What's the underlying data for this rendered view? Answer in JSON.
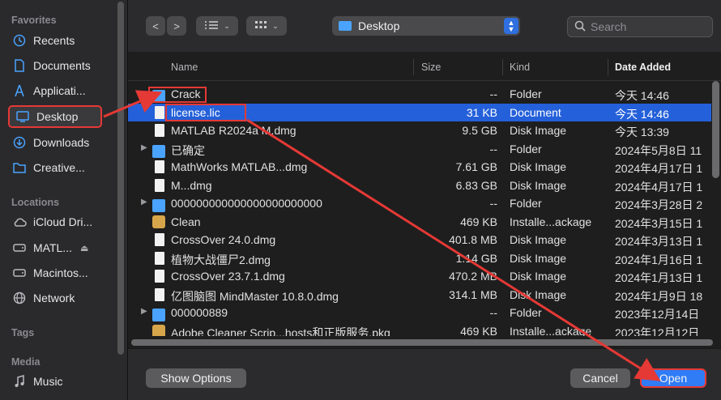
{
  "sidebar": {
    "favorites_label": "Favorites",
    "locations_label": "Locations",
    "tags_label": "Tags",
    "media_label": "Media",
    "favorites": [
      {
        "label": "Recents",
        "icon": "clock-icon"
      },
      {
        "label": "Documents",
        "icon": "document-icon"
      },
      {
        "label": "Applicati...",
        "icon": "applications-icon"
      },
      {
        "label": "Desktop",
        "icon": "desktop-icon"
      },
      {
        "label": "Downloads",
        "icon": "download-icon"
      },
      {
        "label": "Creative...",
        "icon": "folder-icon"
      }
    ],
    "locations": [
      {
        "label": "iCloud Dri...",
        "icon": "cloud-icon"
      },
      {
        "label": "MATL...",
        "icon": "disk-icon"
      },
      {
        "label": "Macintos...",
        "icon": "disk-icon"
      },
      {
        "label": "Network",
        "icon": "globe-icon"
      }
    ],
    "media": [
      {
        "label": "Music",
        "icon": "music-icon"
      }
    ]
  },
  "toolbar": {
    "back": "<",
    "forward": ">",
    "path_label": "Desktop",
    "search_placeholder": "Search"
  },
  "columns": {
    "name": "Name",
    "size": "Size",
    "kind": "Kind",
    "date": "Date Added"
  },
  "rows": [
    {
      "name": "Crack",
      "size": "--",
      "kind": "Folder",
      "date": "今天 14:46",
      "type": "folder",
      "expand": false
    },
    {
      "name": "license.lic",
      "size": "31 KB",
      "kind": "Document",
      "date": "今天 14:46",
      "type": "doc",
      "selected": true
    },
    {
      "name": "MATLAB R2024a M.dmg",
      "size": "9.5 GB",
      "kind": "Disk Image",
      "date": "今天 13:39",
      "type": "doc"
    },
    {
      "name": "已确定",
      "size": "--",
      "kind": "Folder",
      "date": "2024年5月8日 11",
      "type": "folder",
      "expand": true
    },
    {
      "name": "MathWorks MATLAB...dmg",
      "size": "7.61 GB",
      "kind": "Disk Image",
      "date": "2024年4月17日 1",
      "type": "doc"
    },
    {
      "name": "M...dmg",
      "size": "6.83 GB",
      "kind": "Disk Image",
      "date": "2024年4月17日 1",
      "type": "doc"
    },
    {
      "name": "000000000000000000000000",
      "size": "--",
      "kind": "Folder",
      "date": "2024年3月28日 2",
      "type": "folder",
      "expand": true
    },
    {
      "name": "Clean",
      "size": "469 KB",
      "kind": "Installe...ackage",
      "date": "2024年3月15日 1",
      "type": "pkg"
    },
    {
      "name": "CrossOver 24.0.dmg",
      "size": "401.8 MB",
      "kind": "Disk Image",
      "date": "2024年3月13日 1",
      "type": "doc"
    },
    {
      "name": "植物大战僵尸2.dmg",
      "size": "1.14 GB",
      "kind": "Disk Image",
      "date": "2024年1月16日 1",
      "type": "doc"
    },
    {
      "name": "CrossOver 23.7.1.dmg",
      "size": "470.2 MB",
      "kind": "Disk Image",
      "date": "2024年1月13日 1",
      "type": "doc"
    },
    {
      "name": "亿图脑图 MindMaster 10.8.0.dmg",
      "size": "314.1 MB",
      "kind": "Disk Image",
      "date": "2024年1月9日 18",
      "type": "doc"
    },
    {
      "name": "000000889",
      "size": "--",
      "kind": "Folder",
      "date": "2023年12月14日",
      "type": "folder",
      "expand": true
    },
    {
      "name": "Adobe Cleaner Scrip...hosts和正版服务.pkg",
      "size": "469 KB",
      "kind": "Installe...ackage",
      "date": "2023年12月12日",
      "type": "pkg"
    }
  ],
  "footer": {
    "show_options": "Show Options",
    "cancel": "Cancel",
    "open": "Open"
  },
  "colors": {
    "accent": "#2f7cf6",
    "selection": "#2460d9",
    "annotation": "#e53935"
  }
}
